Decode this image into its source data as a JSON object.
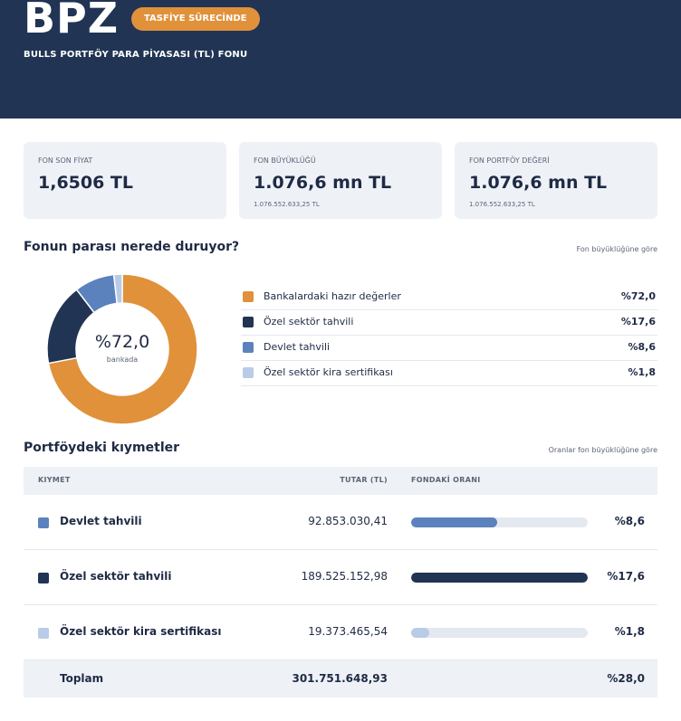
{
  "header": {
    "code": "BPZ",
    "status_badge": "TASFİYE SÜRECİNDE",
    "fund_name": "BULLS PORTFÖY PARA PİYASASI (TL) FONU"
  },
  "stats": [
    {
      "label": "FON SON FİYAT",
      "value": "1,6506 TL",
      "sub": ""
    },
    {
      "label": "FON BÜYÜKLÜĞÜ",
      "value": "1.076,6 mn TL",
      "sub": "1.076.552.633,25 TL"
    },
    {
      "label": "FON PORTFÖY DEĞERİ",
      "value": "1.076,6 mn TL",
      "sub": "1.076.552.633,25 TL"
    }
  ],
  "allocation": {
    "title": "Fonun parası nerede duruyor?",
    "note": "Fon büyüklüğüne göre",
    "center_value": "%72,0",
    "center_caption": "bankada",
    "items": [
      {
        "label": "Bankalardaki hazır değerler",
        "value": "%72,0",
        "share": 72.0,
        "color": "#e0913a"
      },
      {
        "label": "Özel sektör tahvili",
        "value": "%17,6",
        "share": 17.6,
        "color": "#213454"
      },
      {
        "label": "Devlet tahvili",
        "value": "%8,6",
        "share": 8.6,
        "color": "#5b82bd"
      },
      {
        "label": "Özel sektör kira sertifikası",
        "value": "%1,8",
        "share": 1.8,
        "color": "#b9cbe6"
      }
    ]
  },
  "holdings": {
    "title": "Portföydeki kıymetler",
    "note": "Oranlar fon büyüklüğüne göre",
    "columns": {
      "asset": "KIYMET",
      "amount": "TUTAR (TL)",
      "ratio": "FONDAKİ ORANI"
    },
    "rows": [
      {
        "name": "Devlet tahvili",
        "amount": "92.853.030,41",
        "ratio": "%8,6",
        "fill": 0.488,
        "color": "#5b82bd"
      },
      {
        "name": "Özel sektör tahvili",
        "amount": "189.525.152,98",
        "ratio": "%17,6",
        "fill": 1.0,
        "color": "#213454"
      },
      {
        "name": "Özel sektör kira sertifikası",
        "amount": "19.373.465,54",
        "ratio": "%1,8",
        "fill": 0.102,
        "color": "#b9cbe6"
      }
    ],
    "total": {
      "label": "Toplam",
      "amount": "301.751.648,93",
      "ratio": "%28,0"
    }
  }
}
